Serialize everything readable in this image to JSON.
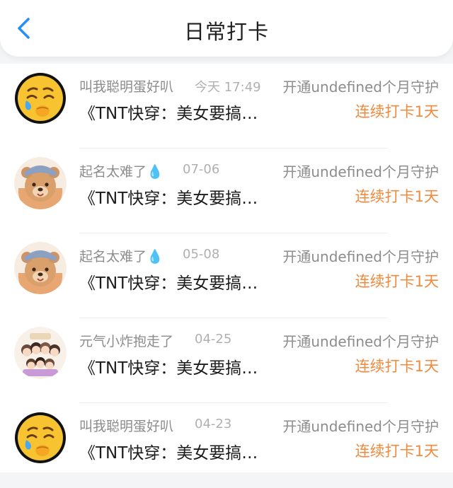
{
  "header": {
    "title": "日常打卡",
    "back_icon": "chevron-left-icon",
    "accent_color": "#2b8ef5"
  },
  "items": [
    {
      "avatar_icon": "crying-face-emoji",
      "name": "叫我聪明蛋好叭",
      "time": "今天 17:49",
      "guard": "开通undefined个月守护",
      "book": "《TNT快穿：美女要搞…",
      "streak": "连续打卡1天"
    },
    {
      "avatar_icon": "bear-avatar",
      "name": "起名太难了💧",
      "time": "07-06",
      "guard": "开通undefined个月守护",
      "book": "《TNT快穿：美女要搞…",
      "streak": "连续打卡1天"
    },
    {
      "avatar_icon": "bear-avatar",
      "name": "起名太难了💧",
      "time": "05-08",
      "guard": "开通undefined个月守护",
      "book": "《TNT快穿：美女要搞…",
      "streak": "连续打卡1天"
    },
    {
      "avatar_icon": "group-cartoon-avatar",
      "name": "元气小炸抱走了",
      "time": "04-25",
      "guard": "开通undefined个月守护",
      "book": "《TNT快穿：美女要搞…",
      "streak": "连续打卡1天"
    },
    {
      "avatar_icon": "crying-face-emoji",
      "name": "叫我聪明蛋好叭",
      "time": "04-23",
      "guard": "开通undefined个月守护",
      "book": "《TNT快穿：美女要搞…",
      "streak": "连续打卡1天"
    }
  ],
  "colors": {
    "streak": "#f08a3e",
    "meta": "#8c8c8c"
  }
}
